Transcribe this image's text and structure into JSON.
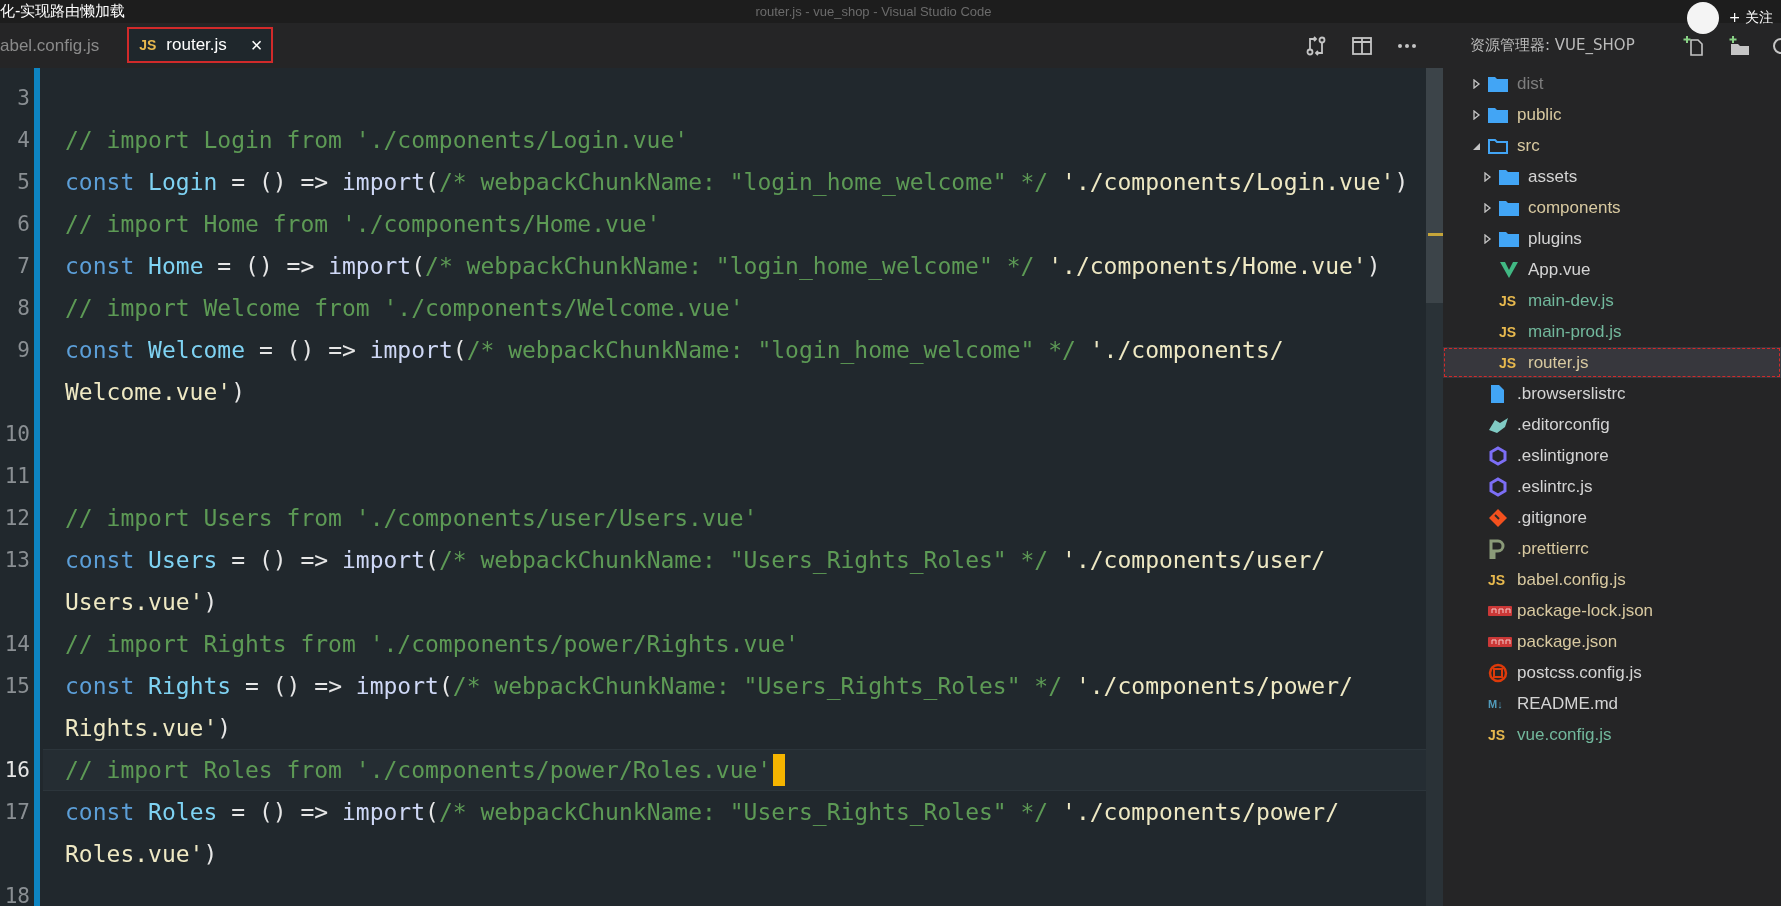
{
  "title_bar": {
    "video_title": "化-实现路由懒加载",
    "window_title": "router.js - vue_shop - Visual Studio Code",
    "follow_button": "+ 关注"
  },
  "tabs": [
    {
      "label": "abel.config.js",
      "selected": false
    },
    {
      "label": "router.js",
      "icon_text": "JS",
      "close": "×",
      "selected": true
    }
  ],
  "sidebar": {
    "title": "资源管理器: VUE_SHOP",
    "items": [
      {
        "label": "dist",
        "kind": "folder",
        "expanded": false,
        "color": "#7e7e7e",
        "selected": false
      },
      {
        "label": "public",
        "kind": "folder",
        "expanded": false,
        "color": "#d8c9a0",
        "selected": false
      },
      {
        "label": "src",
        "kind": "folder",
        "expanded": true,
        "color": "#d8c9a0",
        "selected": false,
        "children": [
          {
            "label": "assets",
            "kind": "folder",
            "expanded": false,
            "color": "#d4d4d4",
            "selected": false
          },
          {
            "label": "components",
            "kind": "folder",
            "expanded": false,
            "color": "#d8c9a0",
            "selected": false
          },
          {
            "label": "plugins",
            "kind": "folder",
            "expanded": false,
            "color": "#d4d4d4",
            "selected": false
          },
          {
            "label": "App.vue",
            "kind": "vue",
            "color": "#d4d4d4",
            "selected": false
          },
          {
            "label": "main-dev.js",
            "kind": "js",
            "icon_text": "JS",
            "color": "#72b89c",
            "selected": false
          },
          {
            "label": "main-prod.js",
            "kind": "js",
            "icon_text": "JS",
            "color": "#72b89c",
            "selected": false
          },
          {
            "label": "router.js",
            "kind": "js",
            "icon_text": "JS",
            "color": "#d8c9a0",
            "selected": true
          }
        ]
      },
      {
        "label": ".browserslistrc",
        "kind": "file",
        "color": "#d4d4d4",
        "selected": false
      },
      {
        "label": ".editorconfig",
        "kind": "editorconfig",
        "color": "#d4d4d4",
        "selected": false
      },
      {
        "label": ".eslintignore",
        "kind": "eslint",
        "color": "#d4d4d4",
        "selected": false
      },
      {
        "label": ".eslintrc.js",
        "kind": "eslint",
        "color": "#d4d4d4",
        "selected": false
      },
      {
        "label": ".gitignore",
        "kind": "git",
        "color": "#d4d4d4",
        "selected": false
      },
      {
        "label": ".prettierrc",
        "kind": "prettier",
        "color": "#d8c9a0",
        "selected": false
      },
      {
        "label": "babel.config.js",
        "kind": "js",
        "icon_text": "JS",
        "color": "#d8c9a0",
        "selected": false
      },
      {
        "label": "package-lock.json",
        "kind": "npm",
        "color": "#d8c9a0",
        "selected": false
      },
      {
        "label": "package.json",
        "kind": "npm",
        "color": "#d8c9a0",
        "selected": false
      },
      {
        "label": "postcss.config.js",
        "kind": "postcss",
        "color": "#d4d4d4",
        "selected": false
      },
      {
        "label": "README.md",
        "kind": "markdown",
        "icon_text": "M↓",
        "color": "#d4d4d4",
        "selected": false
      },
      {
        "label": "vue.config.js",
        "kind": "js",
        "icon_text": "JS",
        "color": "#72b89c",
        "selected": false
      }
    ]
  },
  "editor": {
    "lines": [
      {
        "number": "3",
        "current": false
      },
      {
        "number": "4",
        "current": false,
        "rows": [
          [
            {
              "kind": "comment",
              "text": "// import Login from './components/Login.vue'"
            }
          ]
        ]
      },
      {
        "number": "5",
        "current": false,
        "rows": [
          [
            {
              "kind": "keyword",
              "text": "const"
            },
            {
              "kind": "plain",
              "text": " "
            },
            {
              "kind": "name",
              "text": "Login"
            },
            {
              "kind": "plain",
              "text": " = () => "
            },
            {
              "kind": "call",
              "text": "import"
            },
            {
              "kind": "plain",
              "text": "("
            },
            {
              "kind": "comment",
              "text": "/* webpackChunkName: \"login_home_welcome\" */"
            },
            {
              "kind": "plain",
              "text": " "
            },
            {
              "kind": "string",
              "text": "'./components/Login.vue'"
            },
            {
              "kind": "plain",
              "text": ")"
            }
          ]
        ]
      },
      {
        "number": "6",
        "current": false,
        "rows": [
          [
            {
              "kind": "comment",
              "text": "// import Home from './components/Home.vue'"
            }
          ]
        ]
      },
      {
        "number": "7",
        "current": false,
        "rows": [
          [
            {
              "kind": "keyword",
              "text": "const"
            },
            {
              "kind": "plain",
              "text": " "
            },
            {
              "kind": "name",
              "text": "Home"
            },
            {
              "kind": "plain",
              "text": " = () => "
            },
            {
              "kind": "call",
              "text": "import"
            },
            {
              "kind": "plain",
              "text": "("
            },
            {
              "kind": "comment",
              "text": "/* webpackChunkName: \"login_home_welcome\" */"
            },
            {
              "kind": "plain",
              "text": " "
            },
            {
              "kind": "string",
              "text": "'./components/Home.vue'"
            },
            {
              "kind": "plain",
              "text": ")"
            }
          ]
        ]
      },
      {
        "number": "8",
        "current": false,
        "rows": [
          [
            {
              "kind": "comment",
              "text": "// import Welcome from './components/Welcome.vue'"
            }
          ]
        ]
      },
      {
        "number": "9",
        "current": false,
        "rows": [
          [
            {
              "kind": "keyword",
              "text": "const"
            },
            {
              "kind": "plain",
              "text": " "
            },
            {
              "kind": "name",
              "text": "Welcome"
            },
            {
              "kind": "plain",
              "text": " = () => "
            },
            {
              "kind": "call",
              "text": "import"
            },
            {
              "kind": "plain",
              "text": "("
            },
            {
              "kind": "comment",
              "text": "/* webpackChunkName: \"login_home_welcome\" */"
            },
            {
              "kind": "plain",
              "text": " "
            },
            {
              "kind": "string",
              "text": "'./components/"
            }
          ],
          [
            {
              "kind": "string",
              "text": "Welcome.vue'"
            },
            {
              "kind": "plain",
              "text": ")"
            }
          ]
        ]
      },
      {
        "number": "10",
        "current": false
      },
      {
        "number": "11",
        "current": false
      },
      {
        "number": "12",
        "current": false,
        "rows": [
          [
            {
              "kind": "comment",
              "text": "// import Users from './components/user/Users.vue'"
            }
          ]
        ]
      },
      {
        "number": "13",
        "current": false,
        "rows": [
          [
            {
              "kind": "keyword",
              "text": "const"
            },
            {
              "kind": "plain",
              "text": " "
            },
            {
              "kind": "name",
              "text": "Users"
            },
            {
              "kind": "plain",
              "text": " = () => "
            },
            {
              "kind": "call",
              "text": "import"
            },
            {
              "kind": "plain",
              "text": "("
            },
            {
              "kind": "comment",
              "text": "/* webpackChunkName: \"Users_Rights_Roles\" */"
            },
            {
              "kind": "plain",
              "text": " "
            },
            {
              "kind": "string",
              "text": "'./components/user/"
            }
          ],
          [
            {
              "kind": "string",
              "text": "Users.vue'"
            },
            {
              "kind": "plain",
              "text": ")"
            }
          ]
        ]
      },
      {
        "number": "14",
        "current": false,
        "rows": [
          [
            {
              "kind": "comment",
              "text": "// import Rights from './components/power/Rights.vue'"
            }
          ]
        ]
      },
      {
        "number": "15",
        "current": false,
        "rows": [
          [
            {
              "kind": "keyword",
              "text": "const"
            },
            {
              "kind": "plain",
              "text": " "
            },
            {
              "kind": "name",
              "text": "Rights"
            },
            {
              "kind": "plain",
              "text": " = () => "
            },
            {
              "kind": "call",
              "text": "import"
            },
            {
              "kind": "plain",
              "text": "("
            },
            {
              "kind": "comment",
              "text": "/* webpackChunkName: \"Users_Rights_Roles\" */"
            },
            {
              "kind": "plain",
              "text": " "
            },
            {
              "kind": "string",
              "text": "'./components/power/"
            }
          ],
          [
            {
              "kind": "string",
              "text": "Rights.vue'"
            },
            {
              "kind": "plain",
              "text": ")"
            }
          ]
        ]
      },
      {
        "number": "16",
        "current": true,
        "cursor": true,
        "rows": [
          [
            {
              "kind": "comment",
              "text": "// import Roles from './components/power/Roles.vue'"
            }
          ]
        ]
      },
      {
        "number": "17",
        "current": false,
        "rows": [
          [
            {
              "kind": "keyword",
              "text": "const"
            },
            {
              "kind": "plain",
              "text": " "
            },
            {
              "kind": "name",
              "text": "Roles"
            },
            {
              "kind": "plain",
              "text": " = () => "
            },
            {
              "kind": "call",
              "text": "import"
            },
            {
              "kind": "plain",
              "text": "("
            },
            {
              "kind": "comment",
              "text": "/* webpackChunkName: \"Users_Rights_Roles\" */"
            },
            {
              "kind": "plain",
              "text": " "
            },
            {
              "kind": "string",
              "text": "'./components/power/"
            }
          ],
          [
            {
              "kind": "string",
              "text": "Roles.vue'"
            },
            {
              "kind": "plain",
              "text": ")"
            }
          ]
        ]
      },
      {
        "number": "18",
        "current": false
      }
    ]
  }
}
